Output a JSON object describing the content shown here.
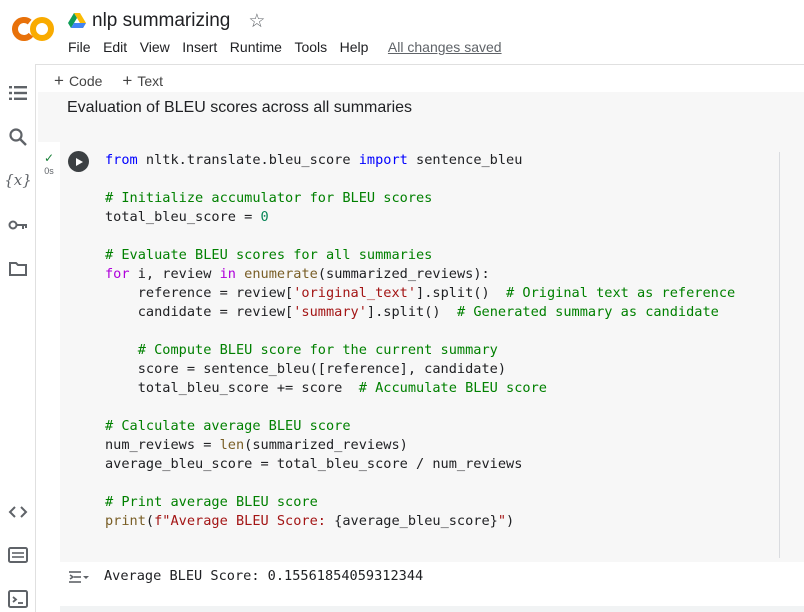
{
  "app": {
    "logo_text": "CO",
    "title": "nlp summarizing",
    "brand_orange": "#f9ab00",
    "brand_dark_orange": "#e8710a"
  },
  "menu": {
    "items": [
      "File",
      "Edit",
      "View",
      "Insert",
      "Runtime",
      "Tools",
      "Help"
    ],
    "status": "All changes saved"
  },
  "toolbar": {
    "code_label": "Code",
    "text_label": "Text"
  },
  "sidebar": {
    "icons": [
      "table-of-contents-icon",
      "search-icon",
      "variables-icon",
      "secrets-key-icon",
      "files-folder-icon",
      "code-snippets-icon",
      "command-palette-icon",
      "terminal-icon"
    ]
  },
  "text_cell": {
    "content": "Evaluation of BLEU scores across all summaries"
  },
  "code_cell": {
    "exec_time": "0s",
    "lines": [
      [
        {
          "t": "from",
          "c": "kw"
        },
        {
          "t": " nltk.translate.bleu_score "
        },
        {
          "t": "import",
          "c": "kw"
        },
        {
          "t": " sentence_bleu"
        }
      ],
      [],
      [
        {
          "t": "# Initialize accumulator for BLEU scores",
          "c": "cm"
        }
      ],
      [
        {
          "t": "total_bleu_score = "
        },
        {
          "t": "0",
          "c": "nm"
        }
      ],
      [],
      [
        {
          "t": "# Evaluate BLEU scores for all summaries",
          "c": "cm"
        }
      ],
      [
        {
          "t": "for",
          "c": "kw2"
        },
        {
          "t": " i, review "
        },
        {
          "t": "in",
          "c": "kw2"
        },
        {
          "t": " "
        },
        {
          "t": "enumerate",
          "c": "bi"
        },
        {
          "t": "(summarized_reviews):"
        }
      ],
      [
        {
          "t": "    reference = review["
        },
        {
          "t": "'original_text'",
          "c": "st"
        },
        {
          "t": "].split()  "
        },
        {
          "t": "# Original text as reference",
          "c": "cm"
        }
      ],
      [
        {
          "t": "    candidate = review["
        },
        {
          "t": "'summary'",
          "c": "st"
        },
        {
          "t": "].split()  "
        },
        {
          "t": "# Generated summary as candidate",
          "c": "cm"
        }
      ],
      [],
      [
        {
          "t": "    # Compute BLEU score for the current summary",
          "c": "cm"
        }
      ],
      [
        {
          "t": "    score = sentence_bleu([reference], candidate)"
        }
      ],
      [
        {
          "t": "    total_bleu_score += score  "
        },
        {
          "t": "# Accumulate BLEU score",
          "c": "cm"
        }
      ],
      [],
      [
        {
          "t": "# Calculate average BLEU score",
          "c": "cm"
        }
      ],
      [
        {
          "t": "num_reviews = "
        },
        {
          "t": "len",
          "c": "bi"
        },
        {
          "t": "(summarized_reviews)"
        }
      ],
      [
        {
          "t": "average_bleu_score = total_bleu_score / num_reviews"
        }
      ],
      [],
      [
        {
          "t": "# Print average BLEU score",
          "c": "cm"
        }
      ],
      [
        {
          "t": "print",
          "c": "bi"
        },
        {
          "t": "("
        },
        {
          "t": "f\"Average BLEU Score: ",
          "c": "st"
        },
        {
          "t": "{average_bleu_score}"
        },
        {
          "t": "\"",
          "c": "st"
        },
        {
          "t": ")"
        }
      ]
    ]
  },
  "output": {
    "text": "Average BLEU Score: 0.15561854059312344"
  }
}
